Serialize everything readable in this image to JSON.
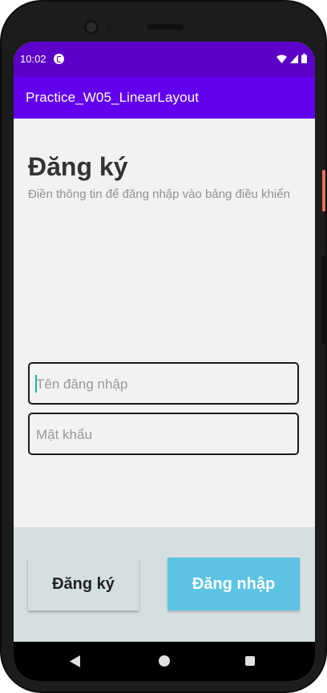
{
  "status_bar": {
    "time": "10:02",
    "icons": [
      "app-notification-icon",
      "wifi-icon",
      "signal-icon",
      "battery-icon"
    ]
  },
  "app_bar": {
    "title": "Practice_W05_LinearLayout"
  },
  "form": {
    "heading": "Đăng ký",
    "subheading": "Điền thông tin để đăng nhập vào bảng điều khiển",
    "username_placeholder": "Tên đăng nhập",
    "username_value": "",
    "password_placeholder": "Mật khẩu",
    "password_value": ""
  },
  "actions": {
    "register_label": "Đăng ký",
    "login_label": "Đăng nhập"
  },
  "nav_bar": {
    "icons": [
      "back-icon",
      "home-icon",
      "recents-icon"
    ]
  },
  "colors": {
    "status_bar": "#5c00c9",
    "app_bar": "#6200ee",
    "login_button": "#5cc3e3",
    "bottom_panel": "#d6dfe0",
    "cursor": "#17b5a8"
  }
}
